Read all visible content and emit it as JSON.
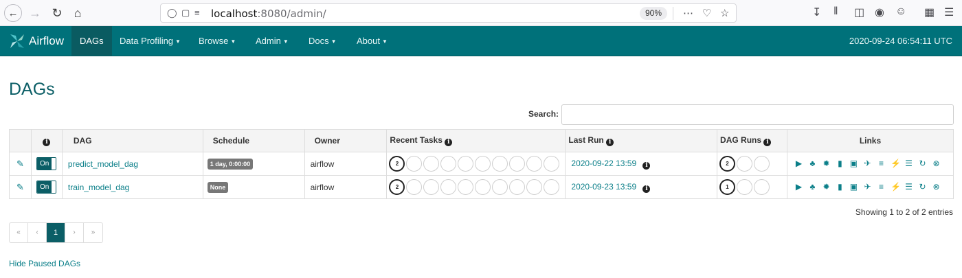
{
  "browser": {
    "url_host": "localhost",
    "url_rest": ":8080/admin/",
    "zoom": "90%"
  },
  "navbar": {
    "brand": "Airflow",
    "items": [
      {
        "label": "DAGs",
        "active": true
      },
      {
        "label": "Data Profiling",
        "dropdown": true
      },
      {
        "label": "Browse",
        "dropdown": true
      },
      {
        "label": "Admin",
        "dropdown": true
      },
      {
        "label": "Docs",
        "dropdown": true
      },
      {
        "label": "About",
        "dropdown": true
      }
    ],
    "clock": "2020-09-24 06:54:11 UTC"
  },
  "page": {
    "title": "DAGs",
    "search_label": "Search:",
    "search_value": ""
  },
  "table": {
    "headers": {
      "info": "i",
      "dag": "DAG",
      "schedule": "Schedule",
      "owner": "Owner",
      "recent_tasks": "Recent Tasks",
      "last_run": "Last Run",
      "dag_runs": "DAG Runs",
      "links": "Links"
    },
    "rows": [
      {
        "toggle": "On",
        "dag": "predict_model_dag",
        "schedule": "1 day, 0:00:00",
        "owner": "airflow",
        "recent_tasks_count": "2",
        "last_run": "2020-09-22 13:59",
        "dag_runs_count": "2"
      },
      {
        "toggle": "On",
        "dag": "train_model_dag",
        "schedule": "None",
        "owner": "airflow",
        "recent_tasks_count": "2",
        "last_run": "2020-09-23 13:59",
        "dag_runs_count": "1"
      }
    ]
  },
  "footer": {
    "entries": "Showing 1 to 2 of 2 entries",
    "pager": [
      "«",
      "‹",
      "1",
      "›",
      "»"
    ],
    "current_page": "1",
    "hide_paused": "Hide Paused DAGs"
  },
  "colors": {
    "navbar": "#00717a",
    "accent": "#0b5e66",
    "link": "#0b7f89"
  }
}
